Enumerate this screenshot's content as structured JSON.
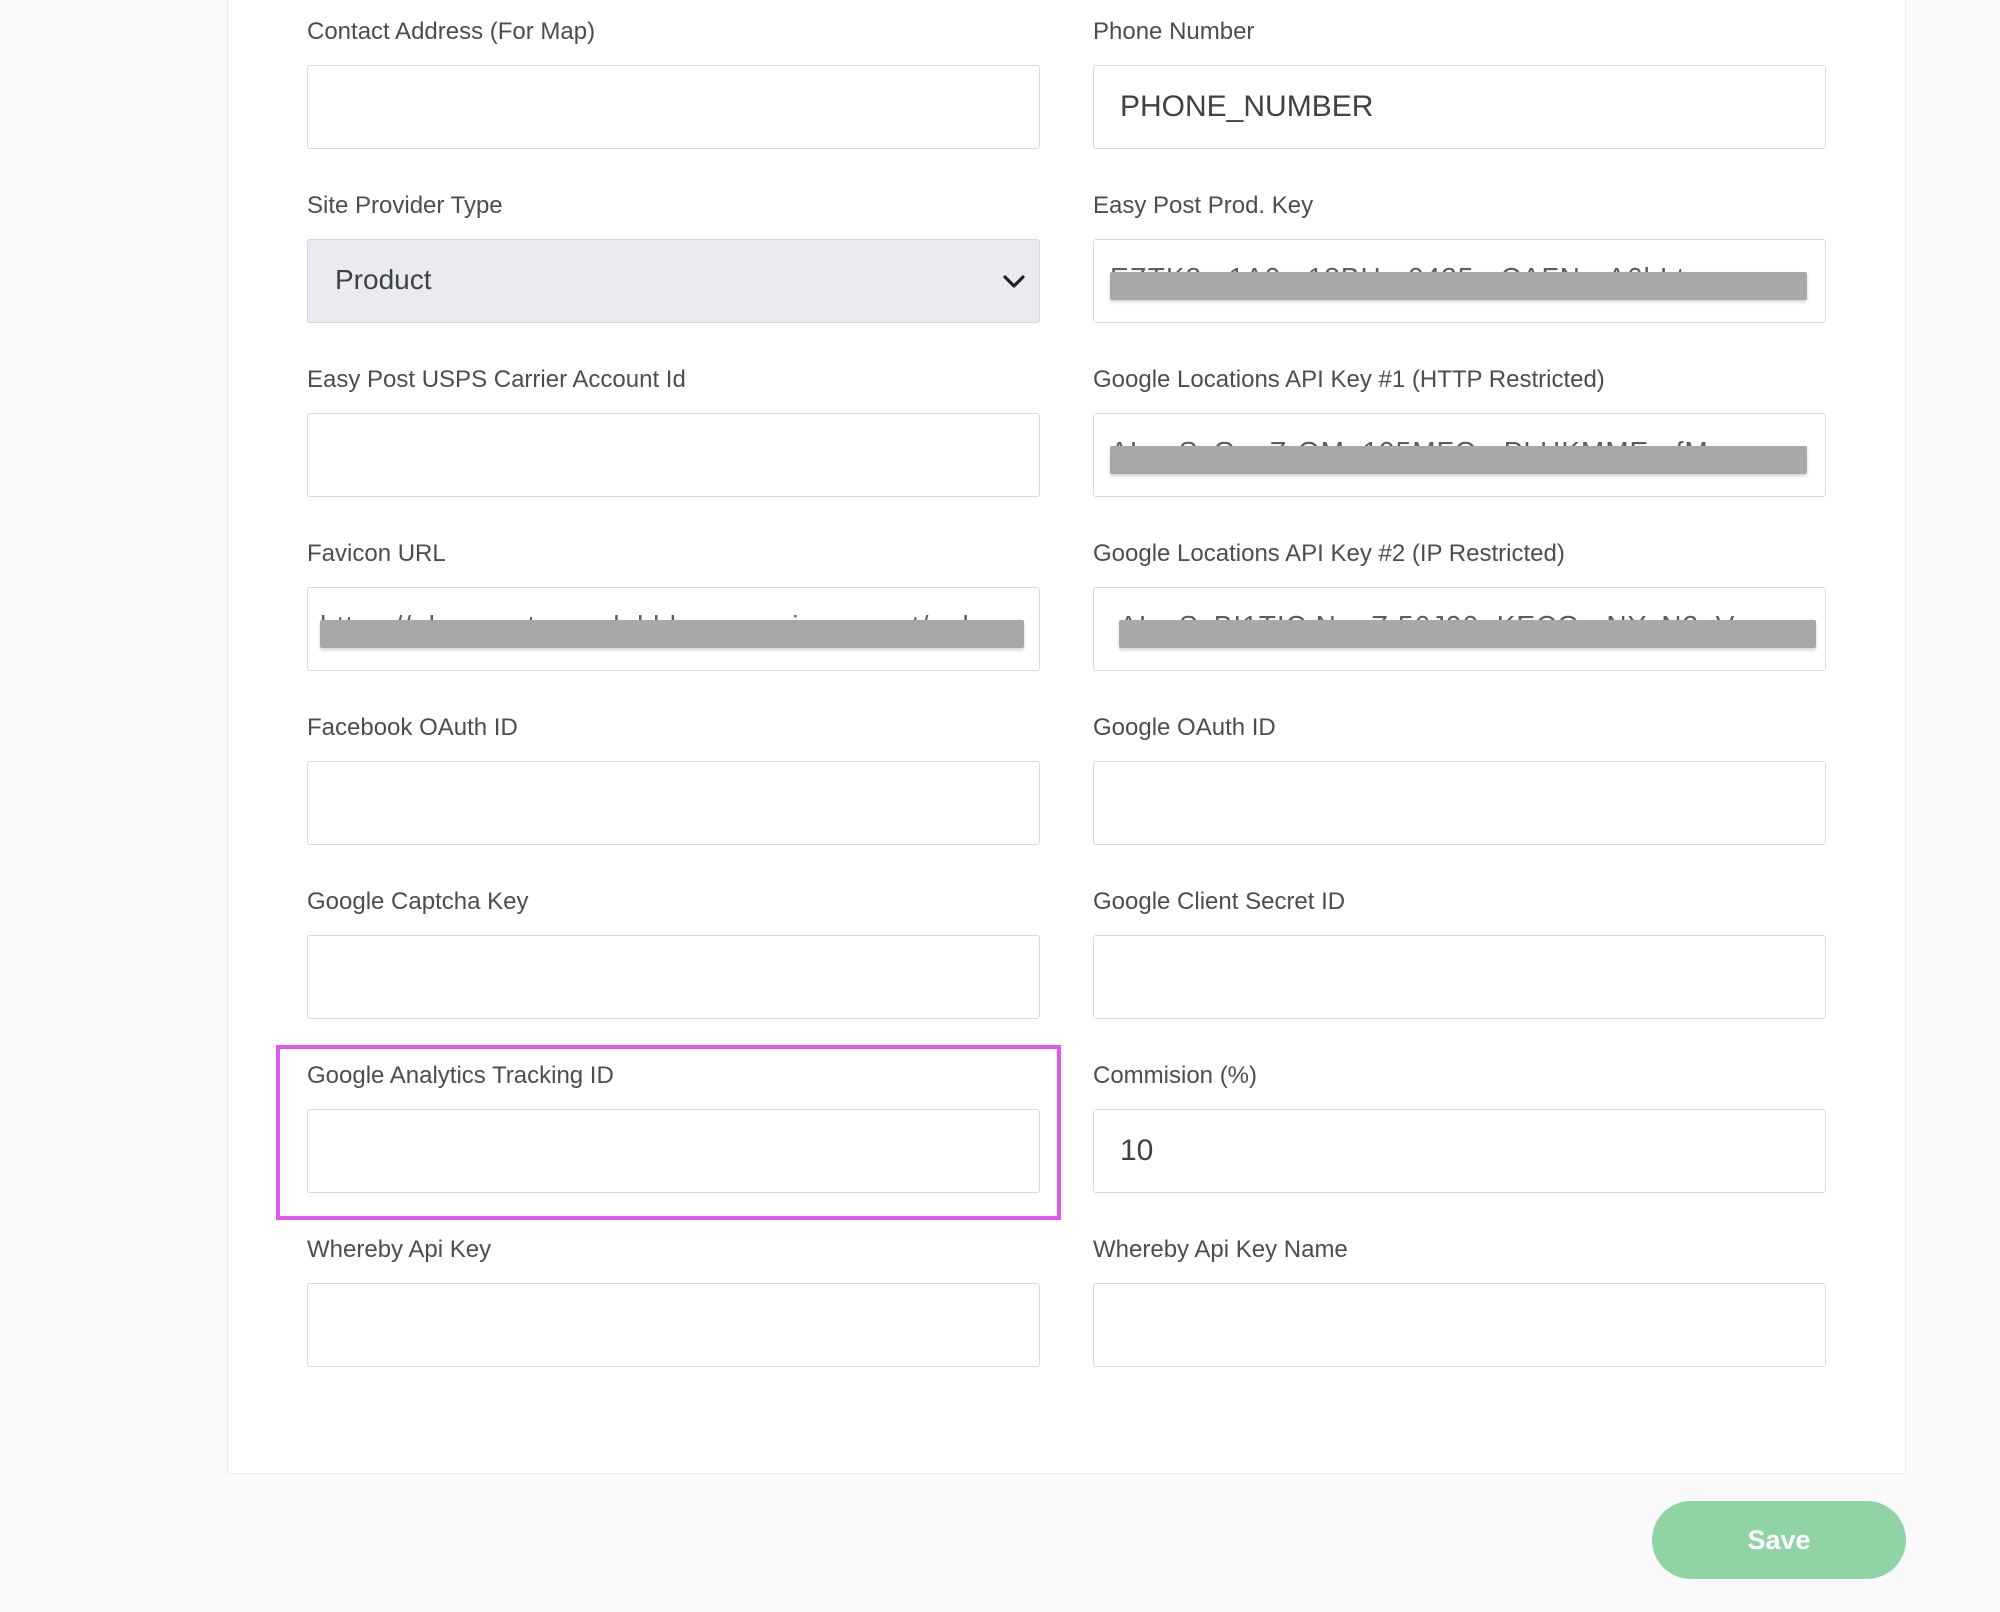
{
  "form": {
    "contact_address": {
      "label": "Contact Address (For Map)",
      "value": ""
    },
    "phone_number": {
      "label": "Phone Number",
      "value": "PHONE_NUMBER"
    },
    "site_provider_type": {
      "label": "Site Provider Type",
      "value": "Product"
    },
    "easy_post_prod_key": {
      "label": "Easy Post Prod. Key",
      "value": "EZTK2...1A0...18BH...0425...CAFN...A6hLt"
    },
    "easy_post_usps_carrier": {
      "label": "Easy Post USPS Carrier Account Id",
      "value": ""
    },
    "google_locations_key_1": {
      "label": "Google Locations API Key #1 (HTTP Restricted)",
      "value": "AIza.SyGuoZrOM..195MFQ...PLHKMME...fM"
    },
    "favicon_url": {
      "label": "Favicon URL",
      "value": "https://uh...mastermedal.blo...amazia...wsnet/uploa"
    },
    "google_locations_key_2": {
      "label": "Google Locations API Key #2 (IP Restricted)",
      "value": "AIzaSyBI1TIC.No..Z.56J90..KECG...NY..N2aVo"
    },
    "facebook_oauth_id": {
      "label": "Facebook OAuth ID",
      "value": ""
    },
    "google_oauth_id": {
      "label": "Google OAuth ID",
      "value": ""
    },
    "google_captcha_key": {
      "label": "Google Captcha Key",
      "value": ""
    },
    "google_client_secret_id": {
      "label": "Google Client Secret ID",
      "value": ""
    },
    "google_analytics_tracking_id": {
      "label": "Google Analytics Tracking ID",
      "value": ""
    },
    "commission": {
      "label": "Commision (%)",
      "value": "10"
    },
    "whereby_api_key": {
      "label": "Whereby Api Key",
      "value": ""
    },
    "whereby_api_key_name": {
      "label": "Whereby Api Key Name",
      "value": ""
    }
  },
  "actions": {
    "save_label": "Save"
  },
  "colors": {
    "highlight": "#e455f0",
    "save_button": "#90d4a6",
    "select_background": "#e9ebee",
    "redaction": "#a8a8a8"
  }
}
